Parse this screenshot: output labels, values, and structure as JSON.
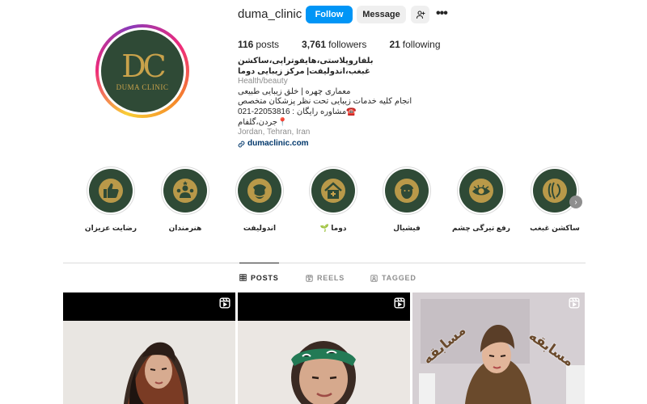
{
  "profile": {
    "username": "duma_clinic",
    "follow_label": "Follow",
    "message_label": "Message",
    "avatar": {
      "monogram": "DC",
      "brand": "DUMA CLINIC"
    },
    "stats": {
      "posts": {
        "count": "116",
        "label": "posts"
      },
      "followers": {
        "count": "3,761",
        "label": "followers"
      },
      "following": {
        "count": "21",
        "label": "following"
      }
    },
    "bio": {
      "title": "بلفاروپلاستی،هایفوتراپی،ساکشن غبغب،اندولیفت| مرکز زیبایی دوما",
      "category": "Health/beauty",
      "line1": "معماری چهره | خلق زیبایی طبیعی",
      "line2": "انجام کلیه خدمات زیبایی تحت نظر پزشکان متخصص",
      "line3": "☎️مشاوره رایگان : 22053816-021",
      "line4": "📍جردن،گلفام",
      "location": "Jordan, Tehran, Iran",
      "link": "dumaclinic.com"
    }
  },
  "highlights": [
    {
      "label": "ساکشن غبغب",
      "icon": "face-profile-icon"
    },
    {
      "label": "رفع تیرگی چشم",
      "icon": "eye-icon"
    },
    {
      "label": "فیشیال",
      "icon": "face-mask-icon"
    },
    {
      "label": "دوما 🌱",
      "icon": "clinic-house-icon"
    },
    {
      "label": "اندولیفت",
      "icon": "face-wrap-icon"
    },
    {
      "label": "هنرمندان",
      "icon": "artists-icon"
    },
    {
      "label": "رضایت عزیزان",
      "icon": "thumbs-up-icon"
    }
  ],
  "tabs": [
    {
      "label": "POSTS",
      "icon": "grid-icon",
      "active": true
    },
    {
      "label": "REELS",
      "icon": "reels-icon",
      "active": false
    },
    {
      "label": "TAGGED",
      "icon": "tagged-icon",
      "active": false
    }
  ],
  "posts": [
    {
      "type": "reel",
      "icon": "reel-icon"
    },
    {
      "type": "reel",
      "icon": "reel-icon"
    },
    {
      "type": "reel",
      "icon": "reel-icon",
      "overlay_text": "مسابقه"
    }
  ],
  "colors": {
    "follow_blue": "#0095f6",
    "brand_green": "#2f4a36",
    "brand_gold": "#c9a24b",
    "link_blue": "#00376b"
  }
}
